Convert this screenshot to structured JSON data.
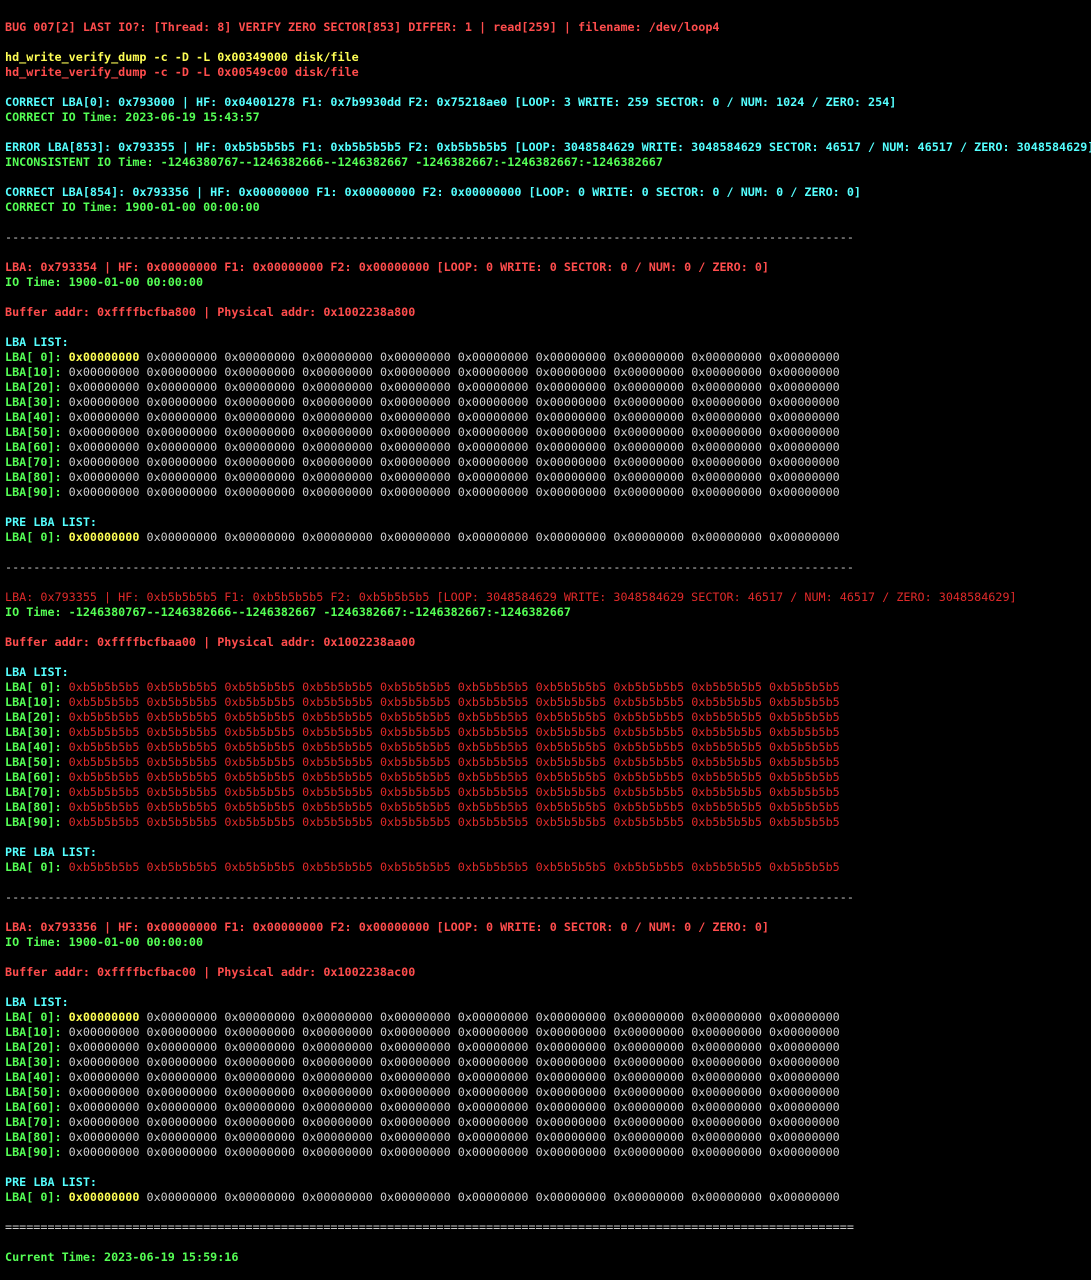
{
  "colors": {
    "background": "#000000",
    "normal": "#d0d0d0",
    "red": "#ff4d4d",
    "dark_red": "#e02a2a",
    "yellow": "#ffff55",
    "cyan": "#55ffff",
    "green": "#55ff55"
  },
  "divider": "------------------------------------------------------------------------------------------------------------------------",
  "final_divider": "========================================================================================================================",
  "bug_line": "BUG 007[2] LAST IO?: [Thread: 8] VERIFY ZERO SECTOR[853] DIFFER: 1 | read[259] | filename: /dev/loop4",
  "commands": [
    "hd_write_verify_dump -c -D -L 0x00349000 disk/file",
    "hd_write_verify_dump -c -D -L 0x00549c00 disk/file"
  ],
  "summary": [
    {
      "lba_line": "CORRECT LBA[0]: 0x793000 | HF: 0x04001278 F1: 0x7b9930dd F2: 0x75218ae0 [LOOP: 3 WRITE: 259 SECTOR: 0 / NUM: 1024 / ZERO: 254]",
      "time_line": "CORRECT IO Time: 2023-06-19 15:43:57"
    },
    {
      "lba_line": "ERROR LBA[853]: 0x793355 | HF: 0xb5b5b5b5 F1: 0xb5b5b5b5 F2: 0xb5b5b5b5 [LOOP: 3048584629 WRITE: 3048584629 SECTOR: 46517 / NUM: 46517 / ZERO: 3048584629]",
      "time_line": "INCONSISTENT IO Time: -1246380767--1246382666--1246382667 -1246382667:-1246382667:-1246382667"
    },
    {
      "lba_line": "CORRECT LBA[854]: 0x793356 | HF: 0x00000000 F1: 0x00000000 F2: 0x00000000 [LOOP: 0 WRITE: 0 SECTOR: 0 / NUM: 0 / ZERO: 0]",
      "time_line": "CORRECT IO Time: 1900-01-00 00:00:00"
    }
  ],
  "blocks": [
    {
      "header": "LBA: 0x793354 | HF: 0x00000000 F1: 0x00000000 F2: 0x00000000 [LOOP: 0 WRITE: 0 SECTOR: 0 / NUM: 0 / ZERO: 0]",
      "io_time": "IO Time: 1900-01-00 00:00:00",
      "buffer": "Buffer addr: 0xffffbcfba800 | Physical addr: 0x1002238a800",
      "lba_list_title": "LBA LIST:",
      "rows": [
        {
          "label": "LBA[ 0]:",
          "first": "0x00000000",
          "rest": "0x00000000 0x00000000 0x00000000 0x00000000 0x00000000 0x00000000 0x00000000 0x00000000 0x00000000"
        },
        {
          "label": "LBA[10]:",
          "first": "0x00000000",
          "rest": "0x00000000 0x00000000 0x00000000 0x00000000 0x00000000 0x00000000 0x00000000 0x00000000 0x00000000"
        },
        {
          "label": "LBA[20]:",
          "first": "0x00000000",
          "rest": "0x00000000 0x00000000 0x00000000 0x00000000 0x00000000 0x00000000 0x00000000 0x00000000 0x00000000"
        },
        {
          "label": "LBA[30]:",
          "first": "0x00000000",
          "rest": "0x00000000 0x00000000 0x00000000 0x00000000 0x00000000 0x00000000 0x00000000 0x00000000 0x00000000"
        },
        {
          "label": "LBA[40]:",
          "first": "0x00000000",
          "rest": "0x00000000 0x00000000 0x00000000 0x00000000 0x00000000 0x00000000 0x00000000 0x00000000 0x00000000"
        },
        {
          "label": "LBA[50]:",
          "first": "0x00000000",
          "rest": "0x00000000 0x00000000 0x00000000 0x00000000 0x00000000 0x00000000 0x00000000 0x00000000 0x00000000"
        },
        {
          "label": "LBA[60]:",
          "first": "0x00000000",
          "rest": "0x00000000 0x00000000 0x00000000 0x00000000 0x00000000 0x00000000 0x00000000 0x00000000 0x00000000"
        },
        {
          "label": "LBA[70]:",
          "first": "0x00000000",
          "rest": "0x00000000 0x00000000 0x00000000 0x00000000 0x00000000 0x00000000 0x00000000 0x00000000 0x00000000"
        },
        {
          "label": "LBA[80]:",
          "first": "0x00000000",
          "rest": "0x00000000 0x00000000 0x00000000 0x00000000 0x00000000 0x00000000 0x00000000 0x00000000 0x00000000"
        },
        {
          "label": "LBA[90]:",
          "first": "0x00000000",
          "rest": "0x00000000 0x00000000 0x00000000 0x00000000 0x00000000 0x00000000 0x00000000 0x00000000 0x00000000"
        }
      ],
      "pre_list_title": "PRE LBA LIST:",
      "pre_row": {
        "label": "LBA[ 0]:",
        "first": "0x00000000",
        "rest": "0x00000000 0x00000000 0x00000000 0x00000000 0x00000000 0x00000000 0x00000000 0x00000000 0x00000000"
      }
    },
    {
      "header": "LBA: 0x793355 | HF: 0xb5b5b5b5 F1: 0xb5b5b5b5 F2: 0xb5b5b5b5 [LOOP: 3048584629 WRITE: 3048584629 SECTOR: 46517 / NUM: 46517 / ZERO: 3048584629]",
      "io_time": "IO Time: -1246380767--1246382666--1246382667 -1246382667:-1246382667:-1246382667",
      "buffer": "Buffer addr: 0xffffbcfbaa00 | Physical addr: 0x1002238aa00",
      "lba_list_title": "LBA LIST:",
      "rows": [
        {
          "label": "LBA[ 0]:",
          "first": "0xb5b5b5b5",
          "rest": "0xb5b5b5b5 0xb5b5b5b5 0xb5b5b5b5 0xb5b5b5b5 0xb5b5b5b5 0xb5b5b5b5 0xb5b5b5b5 0xb5b5b5b5 0xb5b5b5b5"
        },
        {
          "label": "LBA[10]:",
          "first": "0xb5b5b5b5",
          "rest": "0xb5b5b5b5 0xb5b5b5b5 0xb5b5b5b5 0xb5b5b5b5 0xb5b5b5b5 0xb5b5b5b5 0xb5b5b5b5 0xb5b5b5b5 0xb5b5b5b5"
        },
        {
          "label": "LBA[20]:",
          "first": "0xb5b5b5b5",
          "rest": "0xb5b5b5b5 0xb5b5b5b5 0xb5b5b5b5 0xb5b5b5b5 0xb5b5b5b5 0xb5b5b5b5 0xb5b5b5b5 0xb5b5b5b5 0xb5b5b5b5"
        },
        {
          "label": "LBA[30]:",
          "first": "0xb5b5b5b5",
          "rest": "0xb5b5b5b5 0xb5b5b5b5 0xb5b5b5b5 0xb5b5b5b5 0xb5b5b5b5 0xb5b5b5b5 0xb5b5b5b5 0xb5b5b5b5 0xb5b5b5b5"
        },
        {
          "label": "LBA[40]:",
          "first": "0xb5b5b5b5",
          "rest": "0xb5b5b5b5 0xb5b5b5b5 0xb5b5b5b5 0xb5b5b5b5 0xb5b5b5b5 0xb5b5b5b5 0xb5b5b5b5 0xb5b5b5b5 0xb5b5b5b5"
        },
        {
          "label": "LBA[50]:",
          "first": "0xb5b5b5b5",
          "rest": "0xb5b5b5b5 0xb5b5b5b5 0xb5b5b5b5 0xb5b5b5b5 0xb5b5b5b5 0xb5b5b5b5 0xb5b5b5b5 0xb5b5b5b5 0xb5b5b5b5"
        },
        {
          "label": "LBA[60]:",
          "first": "0xb5b5b5b5",
          "rest": "0xb5b5b5b5 0xb5b5b5b5 0xb5b5b5b5 0xb5b5b5b5 0xb5b5b5b5 0xb5b5b5b5 0xb5b5b5b5 0xb5b5b5b5 0xb5b5b5b5"
        },
        {
          "label": "LBA[70]:",
          "first": "0xb5b5b5b5",
          "rest": "0xb5b5b5b5 0xb5b5b5b5 0xb5b5b5b5 0xb5b5b5b5 0xb5b5b5b5 0xb5b5b5b5 0xb5b5b5b5 0xb5b5b5b5 0xb5b5b5b5"
        },
        {
          "label": "LBA[80]:",
          "first": "0xb5b5b5b5",
          "rest": "0xb5b5b5b5 0xb5b5b5b5 0xb5b5b5b5 0xb5b5b5b5 0xb5b5b5b5 0xb5b5b5b5 0xb5b5b5b5 0xb5b5b5b5 0xb5b5b5b5"
        },
        {
          "label": "LBA[90]:",
          "first": "0xb5b5b5b5",
          "rest": "0xb5b5b5b5 0xb5b5b5b5 0xb5b5b5b5 0xb5b5b5b5 0xb5b5b5b5 0xb5b5b5b5 0xb5b5b5b5 0xb5b5b5b5 0xb5b5b5b5"
        }
      ],
      "pre_list_title": "PRE LBA LIST:",
      "pre_row": {
        "label": "LBA[ 0]:",
        "first": "0xb5b5b5b5",
        "rest": "0xb5b5b5b5 0xb5b5b5b5 0xb5b5b5b5 0xb5b5b5b5 0xb5b5b5b5 0xb5b5b5b5 0xb5b5b5b5 0xb5b5b5b5 0xb5b5b5b5"
      }
    },
    {
      "header": "LBA: 0x793356 | HF: 0x00000000 F1: 0x00000000 F2: 0x00000000 [LOOP: 0 WRITE: 0 SECTOR: 0 / NUM: 0 / ZERO: 0]",
      "io_time": "IO Time: 1900-01-00 00:00:00",
      "buffer": "Buffer addr: 0xffffbcfbac00 | Physical addr: 0x1002238ac00",
      "lba_list_title": "LBA LIST:",
      "rows": [
        {
          "label": "LBA[ 0]:",
          "first": "0x00000000",
          "rest": "0x00000000 0x00000000 0x00000000 0x00000000 0x00000000 0x00000000 0x00000000 0x00000000 0x00000000"
        },
        {
          "label": "LBA[10]:",
          "first": "0x00000000",
          "rest": "0x00000000 0x00000000 0x00000000 0x00000000 0x00000000 0x00000000 0x00000000 0x00000000 0x00000000"
        },
        {
          "label": "LBA[20]:",
          "first": "0x00000000",
          "rest": "0x00000000 0x00000000 0x00000000 0x00000000 0x00000000 0x00000000 0x00000000 0x00000000 0x00000000"
        },
        {
          "label": "LBA[30]:",
          "first": "0x00000000",
          "rest": "0x00000000 0x00000000 0x00000000 0x00000000 0x00000000 0x00000000 0x00000000 0x00000000 0x00000000"
        },
        {
          "label": "LBA[40]:",
          "first": "0x00000000",
          "rest": "0x00000000 0x00000000 0x00000000 0x00000000 0x00000000 0x00000000 0x00000000 0x00000000 0x00000000"
        },
        {
          "label": "LBA[50]:",
          "first": "0x00000000",
          "rest": "0x00000000 0x00000000 0x00000000 0x00000000 0x00000000 0x00000000 0x00000000 0x00000000 0x00000000"
        },
        {
          "label": "LBA[60]:",
          "first": "0x00000000",
          "rest": "0x00000000 0x00000000 0x00000000 0x00000000 0x00000000 0x00000000 0x00000000 0x00000000 0x00000000"
        },
        {
          "label": "LBA[70]:",
          "first": "0x00000000",
          "rest": "0x00000000 0x00000000 0x00000000 0x00000000 0x00000000 0x00000000 0x00000000 0x00000000 0x00000000"
        },
        {
          "label": "LBA[80]:",
          "first": "0x00000000",
          "rest": "0x00000000 0x00000000 0x00000000 0x00000000 0x00000000 0x00000000 0x00000000 0x00000000 0x00000000"
        },
        {
          "label": "LBA[90]:",
          "first": "0x00000000",
          "rest": "0x00000000 0x00000000 0x00000000 0x00000000 0x00000000 0x00000000 0x00000000 0x00000000 0x00000000"
        }
      ],
      "pre_list_title": "PRE LBA LIST:",
      "pre_row": {
        "label": "LBA[ 0]:",
        "first": "0x00000000",
        "rest": "0x00000000 0x00000000 0x00000000 0x00000000 0x00000000 0x00000000 0x00000000 0x00000000 0x00000000"
      }
    }
  ],
  "current_time": "Current Time: 2023-06-19 15:59:16"
}
